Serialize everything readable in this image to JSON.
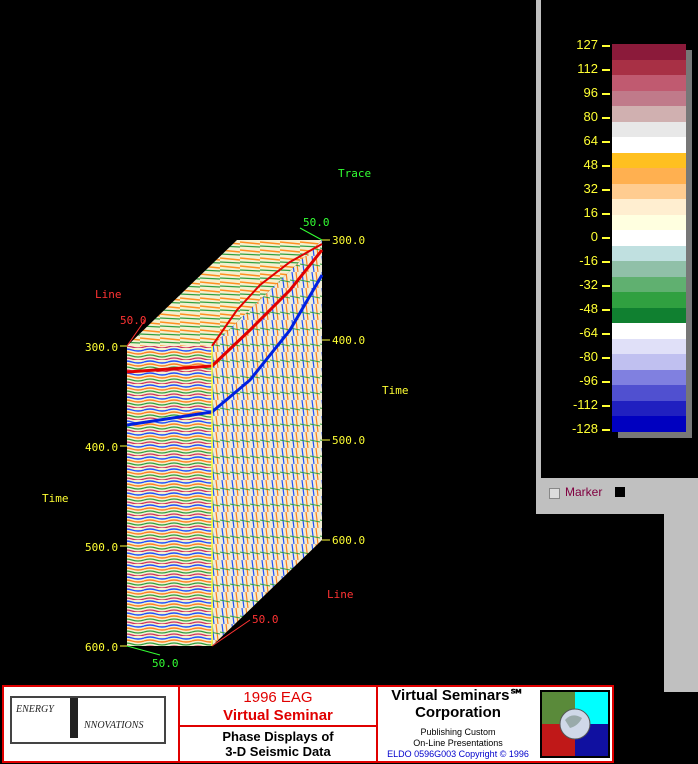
{
  "plot": {
    "trace_label": "Trace",
    "line_label_top": "Line",
    "line_label_bottom": "Line",
    "time_label_left": "Time",
    "time_label_right": "Time",
    "trace_top_value": "50.0",
    "line_top_value": "50.0",
    "line_bottom_value": "50.0",
    "trace_bottom_value": "50.0",
    "left_axis_ticks": [
      "300.0",
      "400.0",
      "500.0",
      "600.0"
    ],
    "right_axis_ticks": [
      "300.0",
      "400.0",
      "500.0",
      "600.0"
    ]
  },
  "colorbar": {
    "ticks": [
      "127",
      "112",
      "96",
      "80",
      "64",
      "48",
      "32",
      "16",
      "0",
      "-16",
      "-32",
      "-48",
      "-64",
      "-80",
      "-96",
      "-112",
      "-128"
    ],
    "colors": [
      "#8b1a3a",
      "#a83045",
      "#c05a70",
      "#c07a8a",
      "#d0b0b0",
      "#e8e8e8",
      "#ffffff",
      "#ffc020",
      "#ffb050",
      "#ffcc90",
      "#ffeed0",
      "#ffffe0",
      "#ffffff",
      "#c0e0e0",
      "#90c0a8",
      "#60b070",
      "#30a040",
      "#108030",
      "#ffffff",
      "#e0e0f8",
      "#c0c0f0",
      "#8080e0",
      "#5050d0",
      "#2020c0",
      "#0000c0"
    ],
    "marker_label": "Marker"
  },
  "banner": {
    "logo_text_1": "ENERGY",
    "logo_text_2": "NNOVATIONS",
    "seminar_line_1": "1996 EAG",
    "seminar_line_2": "Virtual Seminar",
    "topic_line_1": "Phase Displays of",
    "topic_line_2": "3-D Seismic Data",
    "corp_line_1": "Virtual Seminars℠",
    "corp_line_2": "Corporation",
    "corp_sub_1": "Publishing Custom",
    "corp_sub_2": "On-Line Presentations",
    "copyright": "ELDO 0596G003 Copyright © 1996"
  }
}
